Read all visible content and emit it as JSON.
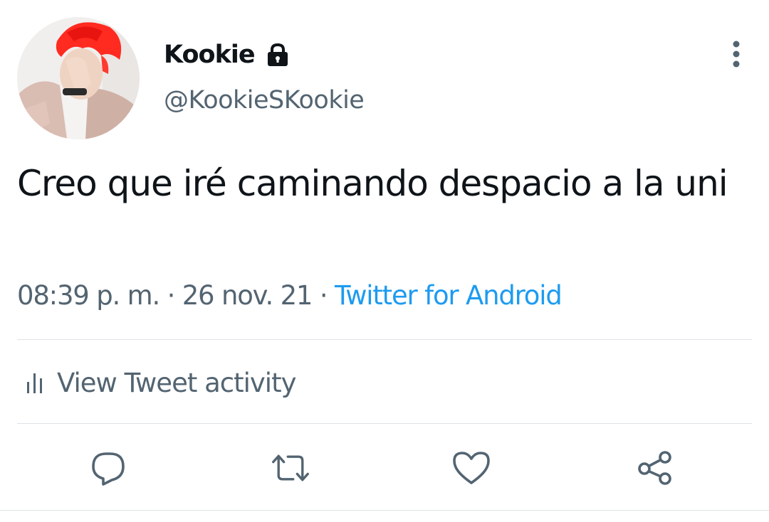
{
  "user": {
    "display_name": "Kookie",
    "handle": "@KookieSKookie",
    "protected_icon": "lock-icon",
    "avatar": "profile-photo"
  },
  "tweet": {
    "text": "Creo que iré caminando despacio a la uni",
    "time": "08:39 p. m.",
    "date": "26 nov. 21",
    "separator": "·",
    "source": "Twitter for Android"
  },
  "activity": {
    "icon": "bar-chart-icon",
    "label": "View Tweet activity"
  },
  "actions": [
    {
      "name": "reply",
      "icon": "reply-icon"
    },
    {
      "name": "retweet",
      "icon": "retweet-icon"
    },
    {
      "name": "like",
      "icon": "heart-icon"
    },
    {
      "name": "share",
      "icon": "share-icon"
    }
  ],
  "colors": {
    "text": "#0f1419",
    "secondary": "#536471",
    "link": "#1d9bf0",
    "divider": "#dfe3e6",
    "icon": "#536471"
  }
}
